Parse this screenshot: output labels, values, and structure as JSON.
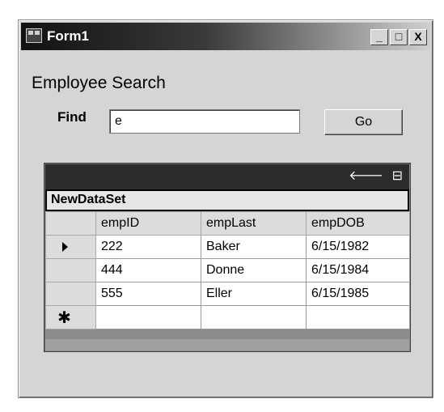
{
  "window": {
    "title": "Form1",
    "minimize_label": "_",
    "maximize_label": "□",
    "close_label": "X"
  },
  "form": {
    "heading": "Employee Search",
    "find_label": "Find",
    "find_value": "e",
    "go_label": "Go"
  },
  "grid": {
    "caption_icons": [
      "back-arrow-icon",
      "show-hide-details-icon"
    ],
    "back_glyph": "🡐",
    "toggle_glyph": "⊟",
    "table_name": "NewDataSet",
    "columns": [
      "empID",
      "empLast",
      "empDOB"
    ],
    "rows": [
      {
        "empID": "222",
        "empLast": "Baker",
        "empDOB": "6/15/1982"
      },
      {
        "empID": "444",
        "empLast": "Donne",
        "empDOB": "6/15/1984"
      },
      {
        "empID": "555",
        "empLast": "Eller",
        "empDOB": "6/15/1985"
      }
    ],
    "new_row_marker": "✱"
  }
}
